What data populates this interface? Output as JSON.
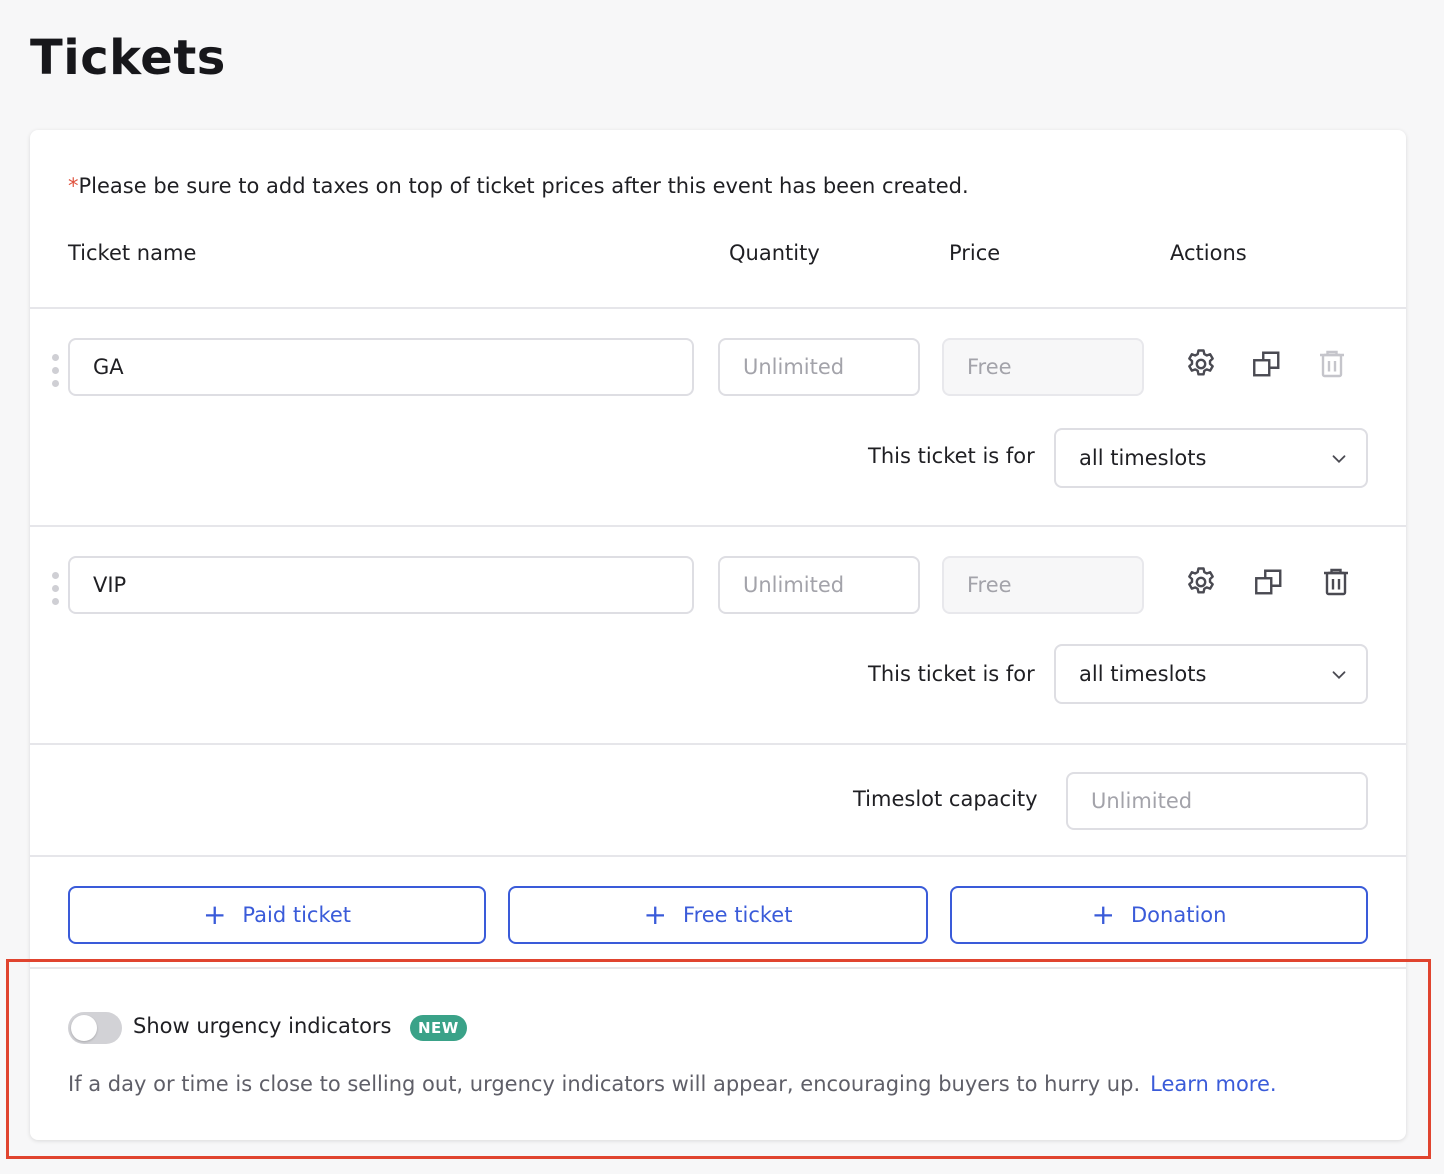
{
  "page": {
    "title": "Tickets"
  },
  "notice": {
    "asterisk": "*",
    "text": "Please be sure to add taxes on top of ticket prices after this event has been created."
  },
  "columns": {
    "name": "Ticket name",
    "quantity": "Quantity",
    "price": "Price",
    "actions": "Actions"
  },
  "tickets": [
    {
      "name": "GA",
      "quantity_placeholder": "Unlimited",
      "price": "Free",
      "for_label": "This ticket is for",
      "timeslot": "all timeslots",
      "delete_enabled": false
    },
    {
      "name": "VIP",
      "quantity_placeholder": "Unlimited",
      "price": "Free",
      "for_label": "This ticket is for",
      "timeslot": "all timeslots",
      "delete_enabled": true
    }
  ],
  "capacity": {
    "label": "Timeslot capacity",
    "placeholder": "Unlimited"
  },
  "add_buttons": {
    "plus": "+",
    "paid": "Paid ticket",
    "free": "Free ticket",
    "donation": "Donation"
  },
  "urgency": {
    "label": "Show urgency indicators",
    "badge": "NEW",
    "enabled": false,
    "description": "If a day or time is close to selling out, urgency indicators will appear, encouraging buyers to hurry up.",
    "link": "Learn more."
  },
  "icons": [
    "gear-icon",
    "duplicate-icon",
    "trash-icon",
    "chevron-down-icon",
    "drag-handle-icon"
  ],
  "colors": {
    "accent": "#3a5bd9",
    "badge": "#3aa288",
    "highlight": "#e0442f",
    "asterisk": "#e0533f"
  }
}
